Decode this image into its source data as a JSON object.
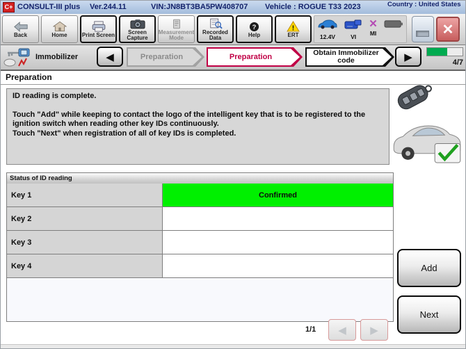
{
  "titlebar": {
    "logo": "C+",
    "app_title": "CONSULT-III plus",
    "version": "Ver.244.11",
    "vin": "VIN:JN8BT3BA5PW408707",
    "vehicle": "Vehicle : ROGUE T33 2023",
    "country": "Country : United States"
  },
  "toolbar": {
    "buttons": [
      {
        "label": "Back"
      },
      {
        "label": "Home"
      },
      {
        "label": "Print Screen"
      },
      {
        "label": "Screen Capture"
      },
      {
        "label": "Measurement Mode"
      },
      {
        "label": "Recorded Data"
      },
      {
        "label": "Help"
      },
      {
        "label": "ERT"
      }
    ],
    "status": {
      "voltage": "12.4V",
      "vi": "VI",
      "mi": "MI"
    }
  },
  "nav": {
    "module": "Immobilizer",
    "steps": [
      {
        "label": "Preparation",
        "state": "completed"
      },
      {
        "label": "Preparation",
        "state": "current"
      },
      {
        "label": "Obtain Immobilizer code",
        "state": "upcoming"
      }
    ],
    "progress": "4/7"
  },
  "page": {
    "title": "Preparation",
    "instructions": {
      "line1": "ID reading is complete.",
      "line2": "Touch \"Add\" while keeping to contact the logo of the intelligent key that is to be registered to the ignition switch when reading other key IDs continuously.",
      "line3": "Touch \"Next\" when registration of all of key IDs is completed."
    },
    "status_table": {
      "header": "Status of ID reading",
      "rows": [
        {
          "key": "Key 1",
          "status": "Confirmed"
        },
        {
          "key": "Key 2",
          "status": ""
        },
        {
          "key": "Key 3",
          "status": ""
        },
        {
          "key": "Key 4",
          "status": ""
        }
      ]
    },
    "actions": {
      "add": "Add",
      "next": "Next"
    },
    "pagination": "1/1"
  },
  "colors": {
    "confirmed_green": "#00f000",
    "active_step_red": "#c00045",
    "titlebar_blue": "#b7cbe5",
    "progress_green": "#00ab50"
  }
}
